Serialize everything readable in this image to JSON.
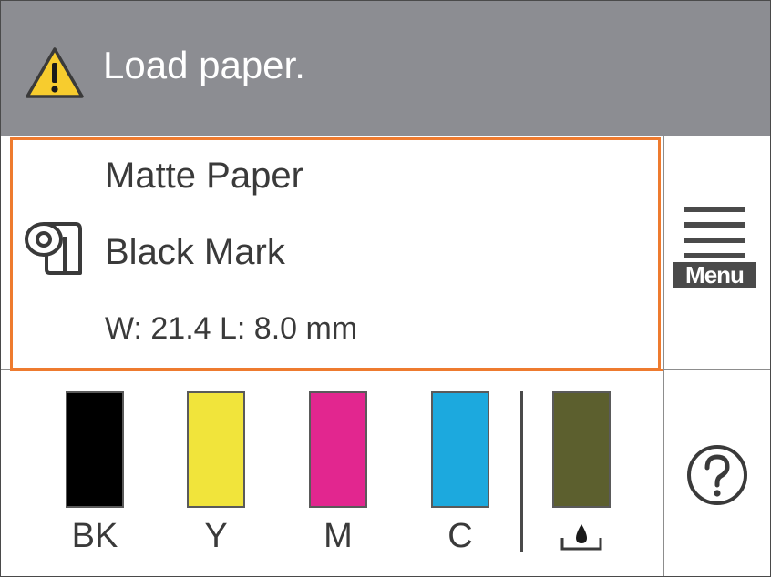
{
  "status": {
    "message": "Load paper.",
    "icon": "warning-icon"
  },
  "media": {
    "type": "Matte Paper",
    "mark": "Black Mark",
    "size": "W: 21.4 L: 8.0 mm",
    "icon": "roll-paper-icon"
  },
  "menu": {
    "label": "Menu",
    "icon": "hamburger-menu-icon"
  },
  "help": {
    "icon": "help-icon"
  },
  "inks": [
    {
      "label": "BK",
      "color": "#000000",
      "level": 1.0
    },
    {
      "label": "Y",
      "color": "#f1e43b",
      "level": 1.0
    },
    {
      "label": "M",
      "color": "#e2268f",
      "level": 1.0
    },
    {
      "label": "C",
      "color": "#1ca9de",
      "level": 1.0
    }
  ],
  "maintenance_box": {
    "icon": "maintenance-box-icon",
    "color": "#5c5f2e",
    "level": 1.0
  },
  "colors": {
    "status_bar": "#8c8d92",
    "accent": "#ee7b2f",
    "warning": "#f7cc2e"
  }
}
